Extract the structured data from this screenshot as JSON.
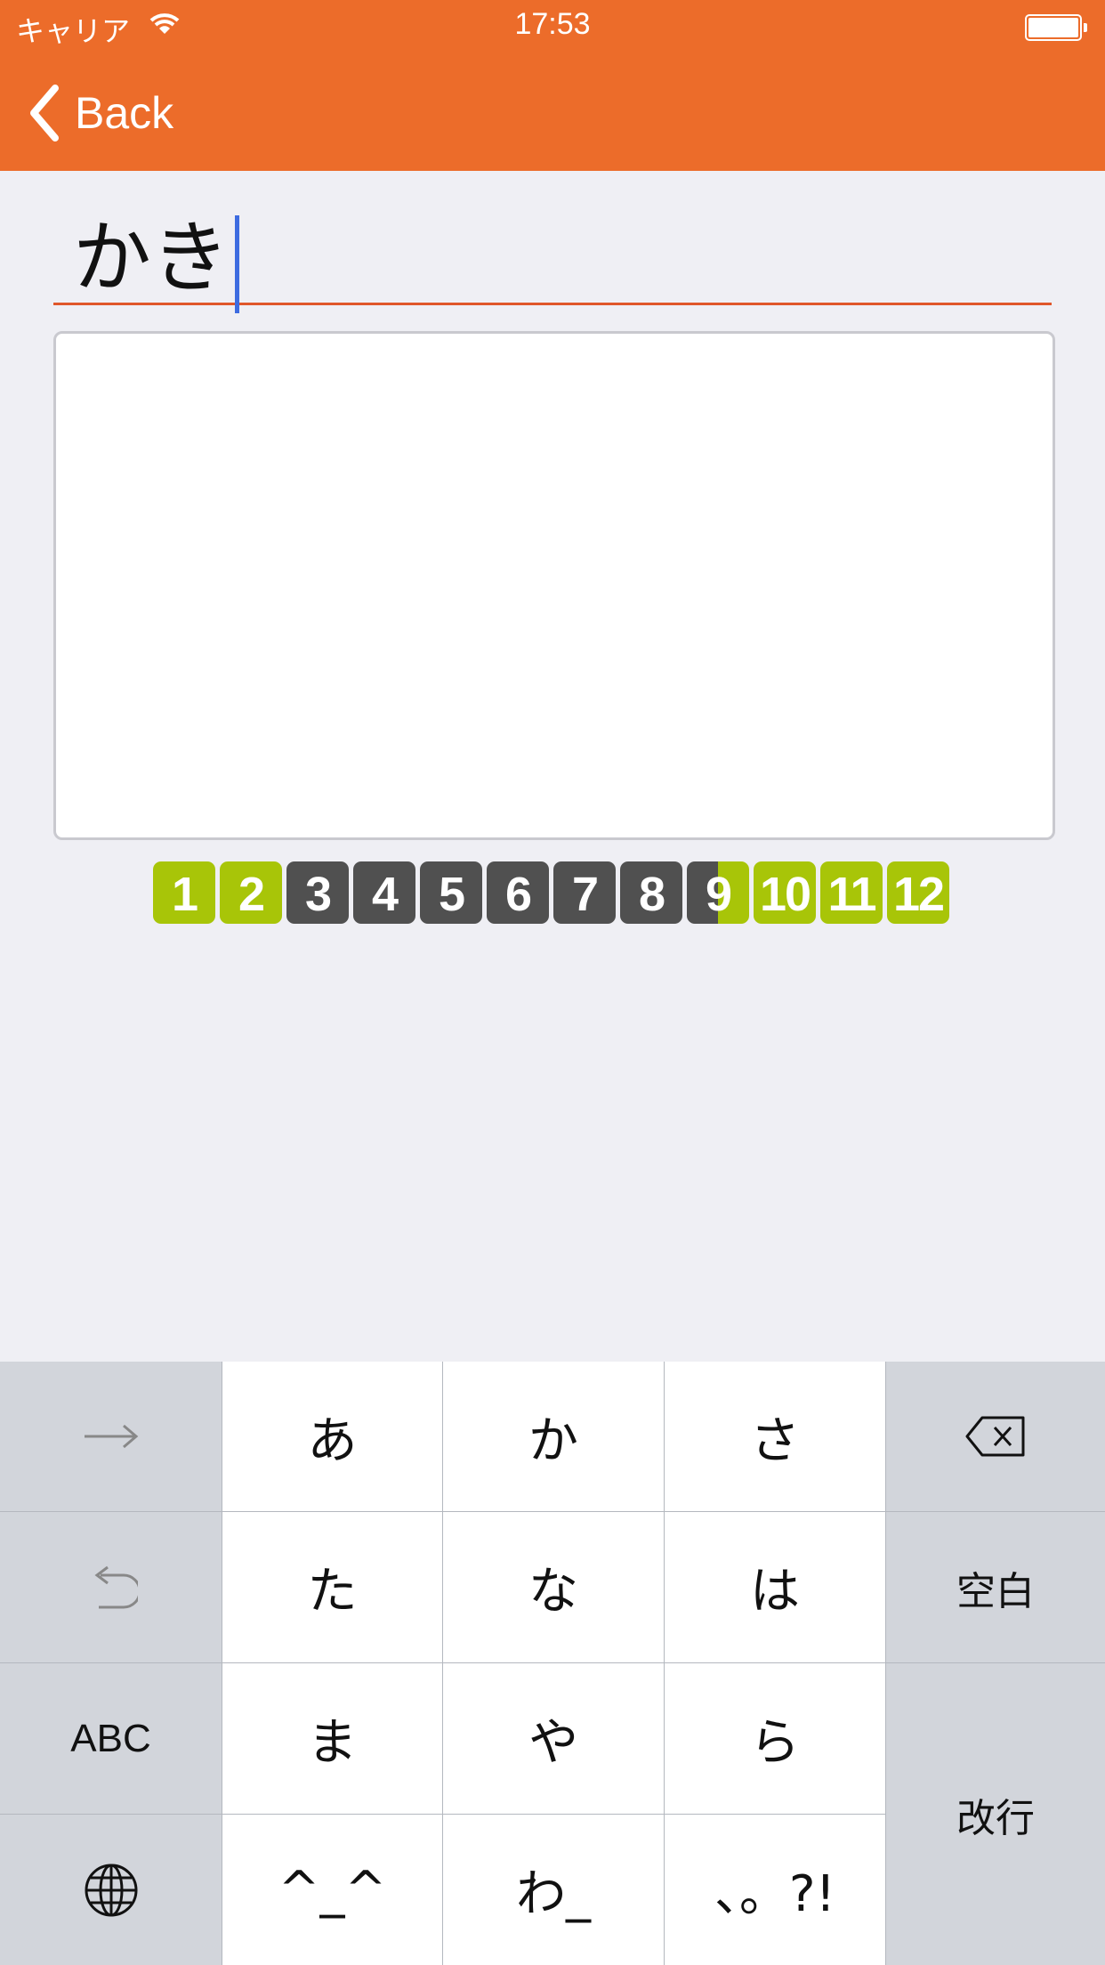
{
  "status_bar": {
    "carrier": "キャリア",
    "time": "17:53"
  },
  "nav": {
    "back_label": "Back"
  },
  "input": {
    "value": "かき"
  },
  "progress": {
    "numbers": [
      "1",
      "2",
      "3",
      "4",
      "5",
      "6",
      "7",
      "8",
      "9",
      "10",
      "11",
      "12"
    ]
  },
  "keyboard": {
    "row1": [
      "あ",
      "か",
      "さ"
    ],
    "row2": [
      "た",
      "な",
      "は"
    ],
    "row3": [
      "ま",
      "や",
      "ら"
    ],
    "row4": [
      "^_^",
      "わ_",
      "、。?!"
    ],
    "space_label": "空白",
    "abc_label": "ABC",
    "return_label": "改行"
  },
  "colors": {
    "accent": "#ec6c2a",
    "done": "#a8c508",
    "todo": "#505050"
  }
}
